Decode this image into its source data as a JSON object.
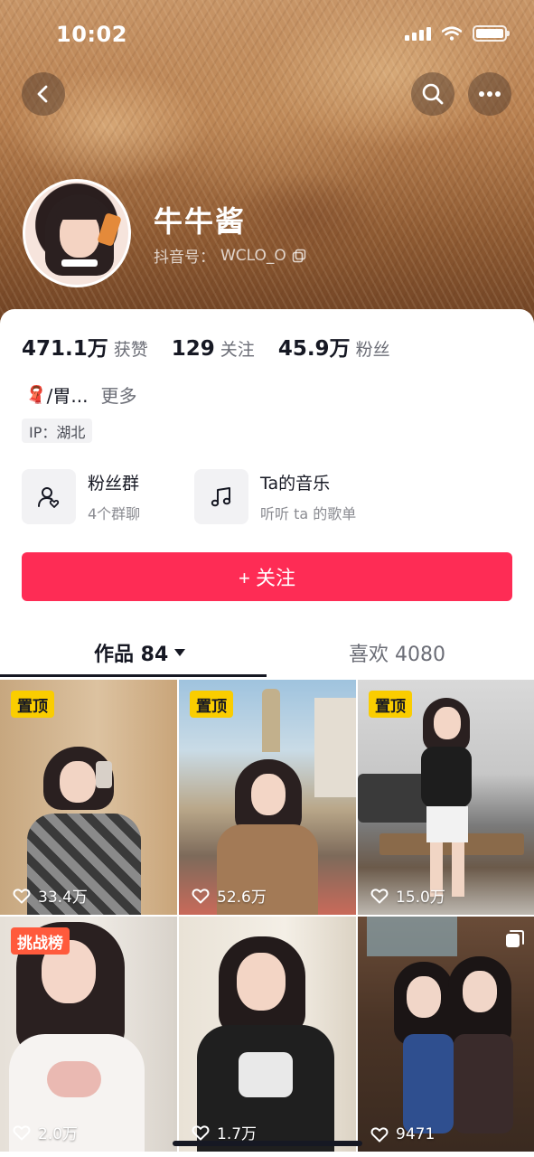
{
  "status_bar": {
    "time": "10:02"
  },
  "header": {
    "back_icon": "chevron-left-icon",
    "search_icon": "search-icon",
    "more_icon": "more-dots-icon"
  },
  "profile": {
    "name": "牛牛酱",
    "douyin_id_label": "抖音号：",
    "douyin_id": "WCLO_O"
  },
  "stats": [
    {
      "value": "471.1万",
      "label": "获赞"
    },
    {
      "value": "129",
      "label": "关注"
    },
    {
      "value": "45.9万",
      "label": "粉丝"
    }
  ],
  "bio": {
    "emoji": "🧣",
    "text": "/胃...",
    "more_label": "更多"
  },
  "ip_location": "IP：湖北",
  "features": [
    {
      "title": "粉丝群",
      "subtitle": "4个群聊",
      "icon": "fan-group-icon"
    },
    {
      "title": "Ta的音乐",
      "subtitle": "听听 ta 的歌单",
      "icon": "music-note-icon"
    }
  ],
  "follow_button": {
    "label": "+ 关注"
  },
  "tabs": [
    {
      "label": "作品 84",
      "active": true
    },
    {
      "label": "喜欢 4080",
      "active": false
    }
  ],
  "videos": [
    {
      "badge": "置顶",
      "badge_type": "pin",
      "likes": "33.4万"
    },
    {
      "badge": "置顶",
      "badge_type": "pin",
      "likes": "52.6万"
    },
    {
      "badge": "置顶",
      "badge_type": "pin",
      "likes": "15.0万"
    },
    {
      "badge": "挑战榜",
      "badge_type": "challenge",
      "likes": "2.0万"
    },
    {
      "badge": "",
      "badge_type": "none",
      "likes": "1.7万"
    },
    {
      "badge": "",
      "badge_type": "multi-image",
      "likes": "9471"
    }
  ],
  "colors": {
    "accent": "#fe2c55",
    "pin_badge": "#facd00",
    "challenge_badge": "#ff5a3c",
    "text_primary": "#161823",
    "text_secondary": "#6b6d76"
  }
}
